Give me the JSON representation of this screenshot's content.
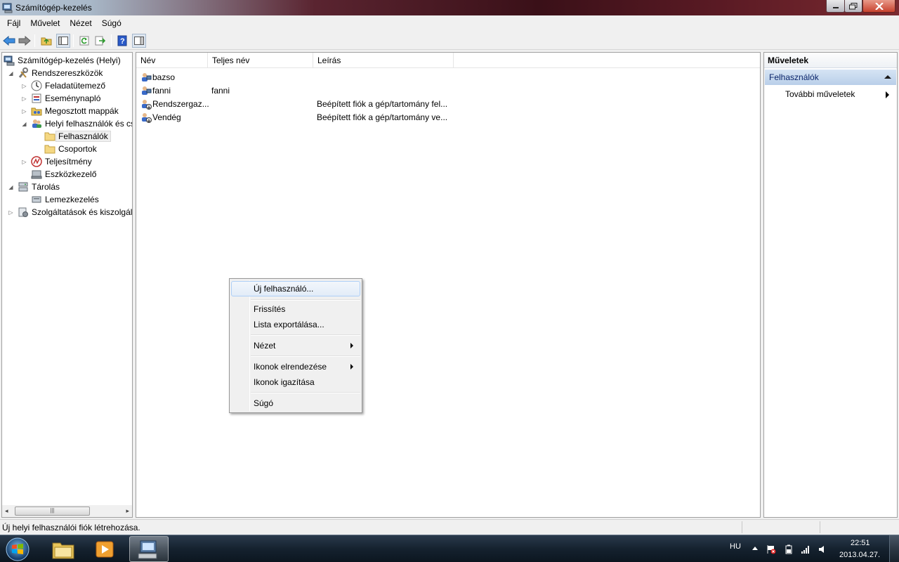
{
  "window": {
    "title": "Számítógép-kezelés"
  },
  "menubar": {
    "items": [
      "Fájl",
      "Művelet",
      "Nézet",
      "Súgó"
    ]
  },
  "tree": {
    "root": "Számítógép-kezelés (Helyi)",
    "system_tools": "Rendszereszközök",
    "task_scheduler": "Feladatütemező",
    "event_viewer": "Eseménynapló",
    "shared_folders": "Megosztott mappák",
    "local_users": "Helyi felhasználók és cs",
    "users": "Felhasználók",
    "groups": "Csoportok",
    "performance": "Teljesítmény",
    "device_manager": "Eszközkezelő",
    "storage": "Tárolás",
    "disk_management": "Lemezkezelés",
    "services": "Szolgáltatások és kiszolgáló"
  },
  "list": {
    "columns": [
      "Név",
      "Teljes név",
      "Leírás"
    ],
    "rows": [
      {
        "name": "bazso",
        "full_name": "",
        "description": ""
      },
      {
        "name": "fanni",
        "full_name": "fanni",
        "description": ""
      },
      {
        "name": "Rendszergaz...",
        "full_name": "",
        "description": "Beépített fiók a gép/tartomány fel..."
      },
      {
        "name": "Vendég",
        "full_name": "",
        "description": "Beépített fiók a gép/tartomány ve..."
      }
    ]
  },
  "actions": {
    "header": "Műveletek",
    "section": "Felhasználók",
    "more": "További műveletek"
  },
  "context_menu": {
    "new_user": "Új felhasználó...",
    "refresh": "Frissítés",
    "export": "Lista exportálása...",
    "view": "Nézet",
    "arrange_icons": "Ikonok elrendezése",
    "align_icons": "Ikonok igazítása",
    "help": "Súgó"
  },
  "statusbar": {
    "text": "Új helyi felhasználói fiók létrehozása."
  },
  "taskbar": {
    "language": "HU",
    "time": "22:51",
    "date": "2013.04.27."
  },
  "colors": {
    "accent": "#aecff7",
    "action_section": "#b9cfe9",
    "taskbar": "#15222f"
  }
}
